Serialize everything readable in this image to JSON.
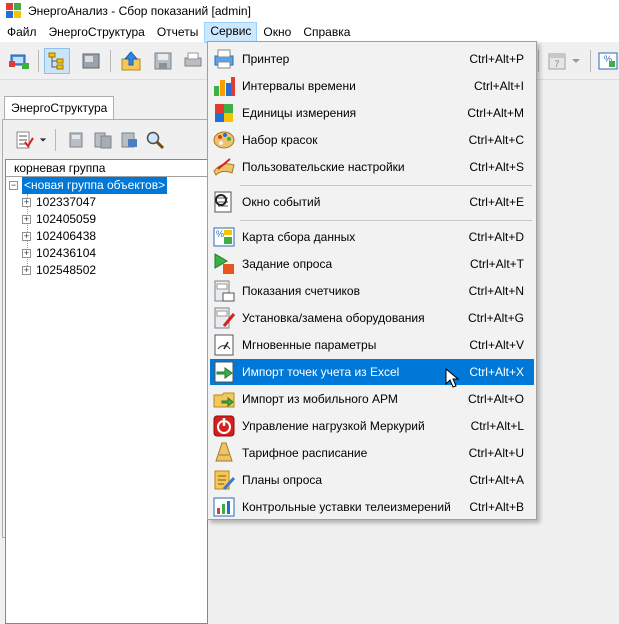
{
  "window": {
    "title": "ЭнергоАнализ - Сбор показаний [admin]"
  },
  "menubar": {
    "items": [
      {
        "label": "Файл"
      },
      {
        "label": "ЭнергоСтруктура"
      },
      {
        "label": "Отчеты"
      },
      {
        "label": "Сервис",
        "active": true
      },
      {
        "label": "Окно"
      },
      {
        "label": "Справка"
      }
    ]
  },
  "toolbar": {
    "calendar_day": "7"
  },
  "panel": {
    "tab": "ЭнергоСтруктура",
    "tree_header": "корневая группа",
    "root_node": "<новая группа объектов>",
    "nodes": [
      "102337047",
      "102405059",
      "102406438",
      "102436104",
      "102548502"
    ]
  },
  "menu": {
    "items": [
      {
        "label": "Принтер",
        "shortcut": "Ctrl+Alt+P",
        "icon": "printer-icon"
      },
      {
        "label": "Интервалы времени",
        "shortcut": "Ctrl+Alt+I",
        "icon": "time-intervals-icon"
      },
      {
        "label": "Единицы измерения",
        "shortcut": "Ctrl+Alt+M",
        "icon": "units-icon"
      },
      {
        "label": "Набор красок",
        "shortcut": "Ctrl+Alt+C",
        "icon": "palette-icon"
      },
      {
        "label": "Пользовательские настройки",
        "shortcut": "Ctrl+Alt+S",
        "icon": "user-settings-icon"
      },
      {
        "label": "Окно событий",
        "shortcut": "Ctrl+Alt+E",
        "icon": "event-window-icon"
      },
      {
        "label": "Карта сбора данных",
        "shortcut": "Ctrl+Alt+D",
        "icon": "data-map-icon"
      },
      {
        "label": "Задание опроса",
        "shortcut": "Ctrl+Alt+T",
        "icon": "poll-task-icon"
      },
      {
        "label": "Показания счетчиков",
        "shortcut": "Ctrl+Alt+N",
        "icon": "meter-readings-icon"
      },
      {
        "label": "Установка/замена оборудования",
        "shortcut": "Ctrl+Alt+G",
        "icon": "equipment-icon"
      },
      {
        "label": "Мгновенные параметры",
        "shortcut": "Ctrl+Alt+V",
        "icon": "gauge-icon"
      },
      {
        "label": "Импорт точек учета из Excel",
        "shortcut": "Ctrl+Alt+X",
        "icon": "import-excel-icon",
        "hover": true
      },
      {
        "label": "Импорт из мобильного АРМ",
        "shortcut": "Ctrl+Alt+O",
        "icon": "folder-import-icon"
      },
      {
        "label": "Управление нагрузкой Меркурий",
        "shortcut": "Ctrl+Alt+L",
        "icon": "power-icon"
      },
      {
        "label": "Тарифное расписание",
        "shortcut": "Ctrl+Alt+U",
        "icon": "tariff-icon"
      },
      {
        "label": "Планы опроса",
        "shortcut": "Ctrl+Alt+A",
        "icon": "poll-plan-icon"
      },
      {
        "label": "Контрольные уставки телеизмерений",
        "shortcut": "Ctrl+Alt+B",
        "icon": "telemetry-setpoints-icon"
      }
    ]
  }
}
